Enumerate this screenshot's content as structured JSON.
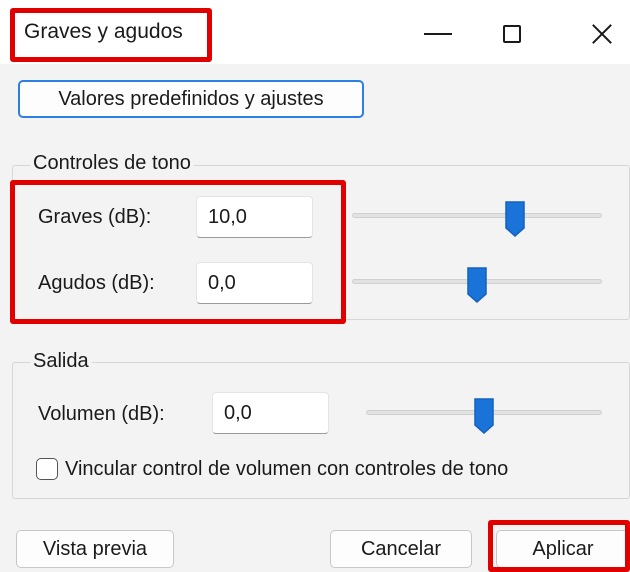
{
  "window": {
    "title": "Graves y agudos",
    "controls": {
      "minimize": "minimize-icon",
      "maximize": "maximize-icon",
      "close": "close-icon"
    }
  },
  "presets_button": "Valores predefinidos y ajustes",
  "tone_controls": {
    "label": "Controles de tono",
    "bass": {
      "label": "Graves (dB):",
      "value": "10,0",
      "slider_level": 0.65
    },
    "treble": {
      "label": "Agudos (dB):",
      "value": "0,0",
      "slider_level": 0.5
    }
  },
  "output": {
    "label": "Salida",
    "volume": {
      "label": "Volumen (dB):",
      "value": "0,0",
      "slider_level": 0.5
    },
    "link_checkbox": {
      "label": "Vincular control de volumen con controles de tono",
      "checked": false
    }
  },
  "footer": {
    "preview": "Vista previa",
    "cancel": "Cancelar",
    "apply": "Aplicar"
  },
  "colors": {
    "accent": "#1a73d9",
    "highlight": "#e00000",
    "dialog_bg": "#f3f3f3"
  }
}
